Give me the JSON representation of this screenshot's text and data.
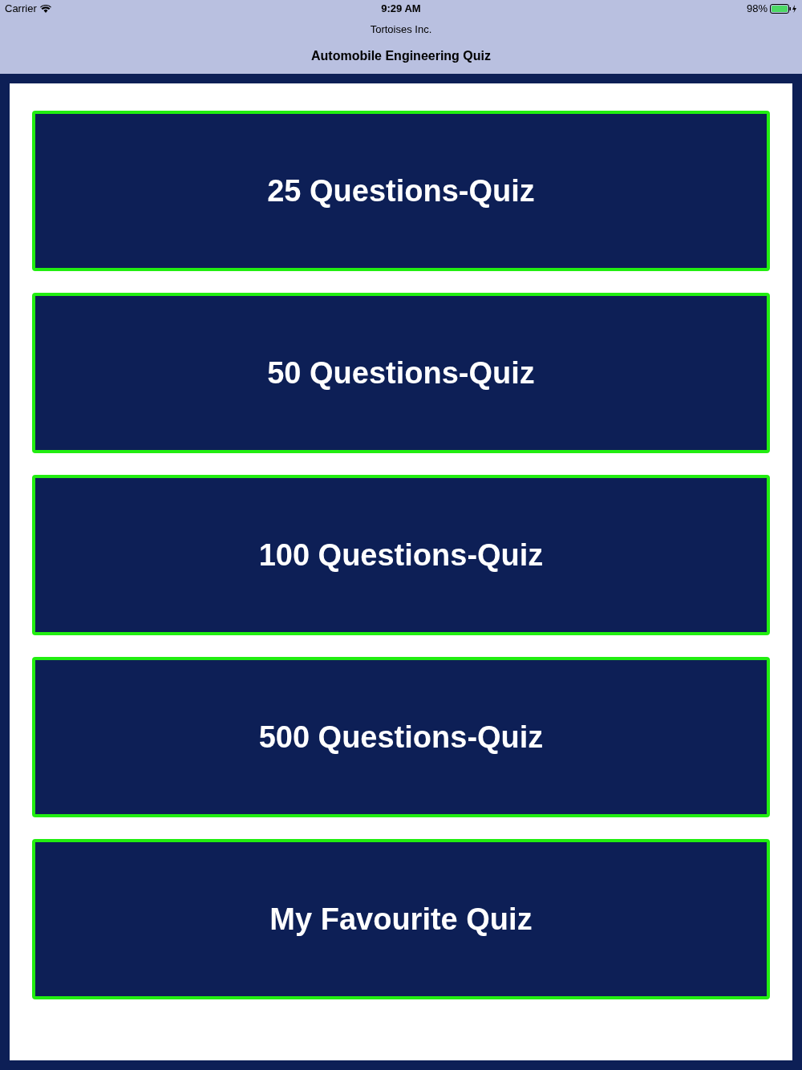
{
  "status_bar": {
    "carrier": "Carrier",
    "time": "9:29 AM",
    "battery": "98%"
  },
  "header": {
    "subtitle": "Tortoises Inc.",
    "title": "Automobile Engineering Quiz"
  },
  "quiz_buttons": [
    {
      "label": "25 Questions-Quiz"
    },
    {
      "label": "50 Questions-Quiz"
    },
    {
      "label": "100 Questions-Quiz"
    },
    {
      "label": "500 Questions-Quiz"
    },
    {
      "label": "My Favourite Quiz"
    }
  ]
}
